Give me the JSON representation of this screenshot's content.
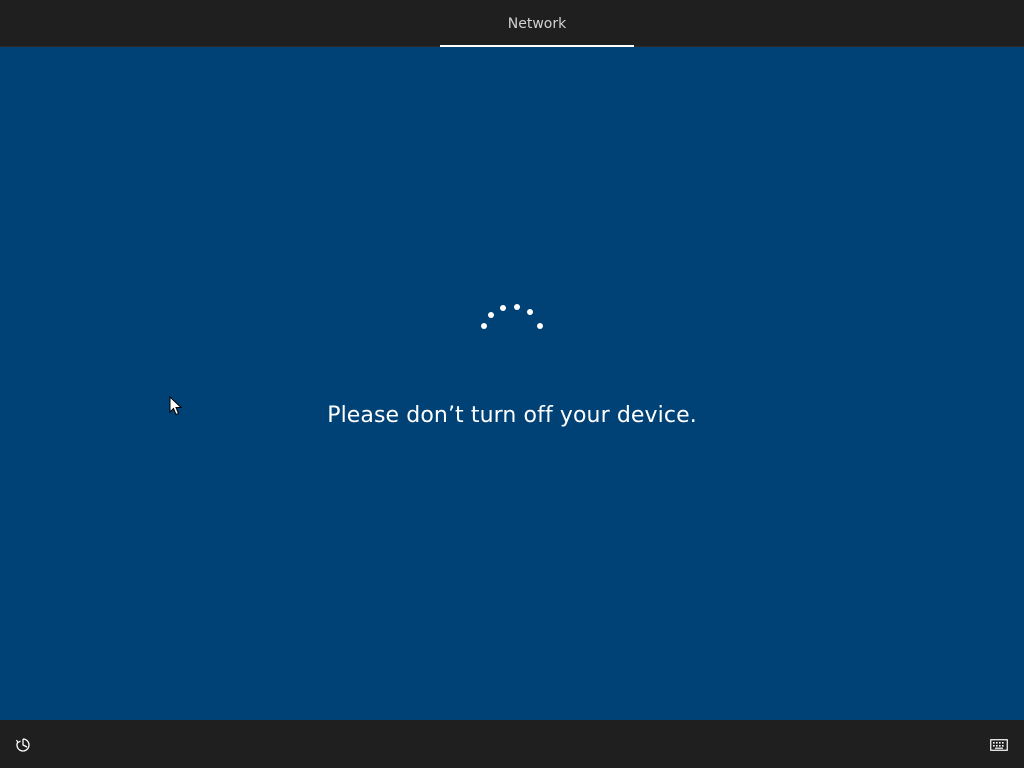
{
  "header": {
    "tabs": [
      {
        "label": "Network",
        "active": true
      }
    ]
  },
  "main": {
    "message": "Please don’t turn off your device.",
    "spinner_icon": "loading-dots-icon"
  },
  "footer": {
    "left_icon": "ease-of-access-icon",
    "right_icon": "keyboard-icon"
  },
  "colors": {
    "background": "#004275",
    "bars": "#1f1f1f",
    "text": "#ffffff",
    "tab_text": "#d2d2d2"
  }
}
